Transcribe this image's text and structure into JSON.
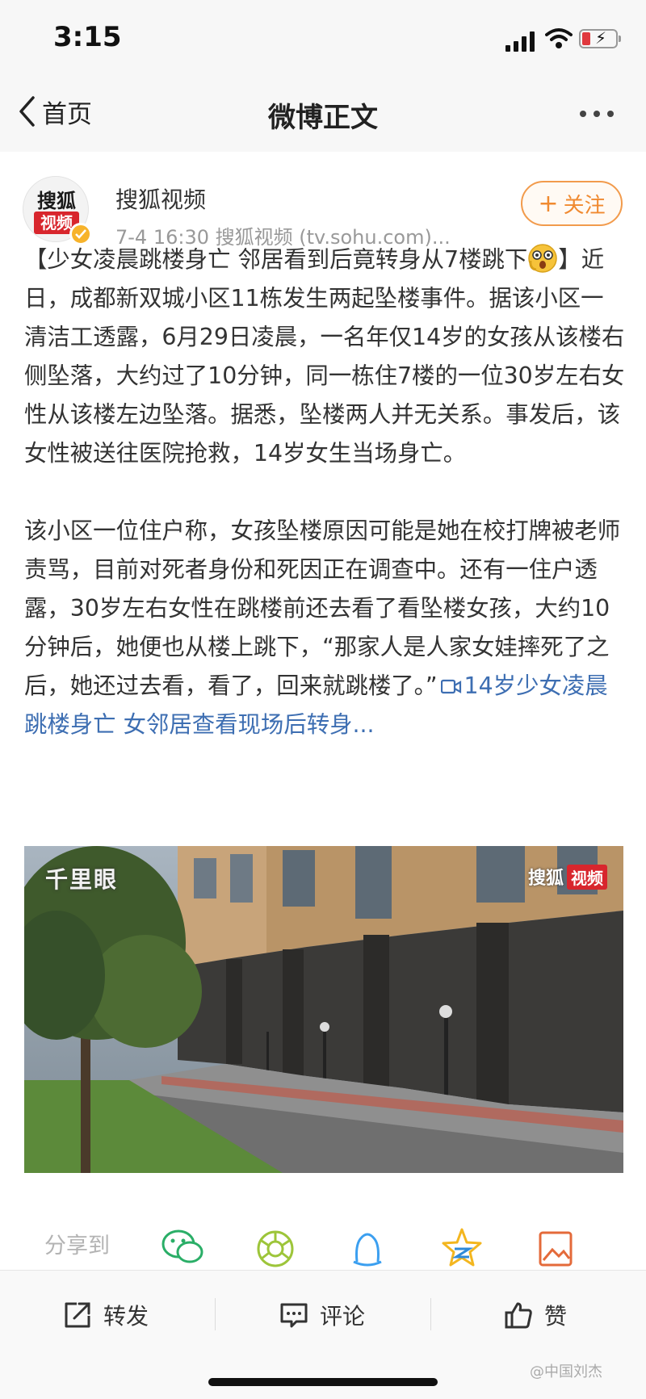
{
  "status_bar": {
    "time": "3:15"
  },
  "nav": {
    "back_label": "首页",
    "title": "微博正文"
  },
  "post": {
    "avatar": {
      "line1": "搜狐",
      "line2": "视频"
    },
    "author": "搜狐视频",
    "meta": "7-4 16:30   搜狐视频 (tv.sohu.com)...",
    "follow_label": "关注",
    "text_p1_a": "【少女凌晨跳楼身亡 邻居看到后竟转身从7楼跳下",
    "text_p1_b": "】近日，成都新双城小区11栋发生两起坠楼事件。据该小区一清洁工透露，6月29日凌晨，一名年仅14岁的女孩从该楼右侧坠落，大约过了10分钟，同一栋住7楼的一位30岁左右女性从该楼左边坠落。据悉，坠楼两人并无关系。事发后，该女性被送往医院抢救，14岁女生当场身亡。",
    "text_p2": "该小区一位住户称，女孩坠楼原因可能是她在校打牌被老师责骂，目前对死者身份和死因正在调查中。还有一住户透露，30岁左右女性在跳楼前还去看了看坠楼女孩，大约10分钟后，她便也从楼上跳下，“那家人是人家女娃摔死了之后，她还过去看，看了，回来就跳楼了。”",
    "video_link": "14岁少女凌晨跳楼身亡 女邻居查看现场后转身...",
    "video": {
      "watermark_left": "千里眼",
      "watermark_right_a": "搜狐",
      "watermark_right_b": "视频"
    }
  },
  "share": {
    "label": "分享到",
    "targets": [
      "wechat-icon",
      "moments-icon",
      "qq-icon",
      "qzone-icon",
      "image-share-icon"
    ]
  },
  "toolbar": {
    "repost": "转发",
    "comment": "评论",
    "like": "赞"
  },
  "watermark": "@中国刘杰",
  "colors": {
    "accent_orange": "#f08a30",
    "link_blue": "#3d6eb2",
    "share_green": "#2aae67"
  }
}
